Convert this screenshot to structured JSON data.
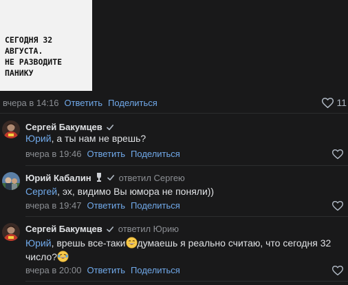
{
  "post": {
    "image_text_line1": "СЕГОДНЯ 32 АВГУСТА.",
    "image_text_line2": "НЕ РАЗВОДИТЕ ПАНИКУ",
    "time": "вчера в 14:16",
    "reply_label": "Ответить",
    "share_label": "Поделиться",
    "likes": "11"
  },
  "comments": [
    {
      "author": "Сергей Бакумцев",
      "reply_to": "",
      "mention": "Юрий",
      "text": ", а ты нам не врешь?",
      "time": "вчера в 19:46",
      "reply_label": "Ответить",
      "share_label": "Поделиться"
    },
    {
      "author": "Юрий Кабалин",
      "reply_to": "ответил Сергею",
      "mention": "Сергей",
      "text": ", эх, видимо Вы юмора не поняли))",
      "time": "вчера в 19:47",
      "reply_label": "Ответить",
      "share_label": "Поделиться"
    },
    {
      "author": "Сергей Бакумцев",
      "reply_to": "ответил Юрию",
      "mention": "Юрий",
      "text_part1": ", врешь все-таки",
      "text_part2": "думаешь я реально считаю, что сегодня 32 число?",
      "time": "вчера в 20:00",
      "reply_label": "Ответить",
      "share_label": "Поделиться"
    }
  ],
  "icons": {
    "like": "heart-icon",
    "verified": "check-icon",
    "badge": "trophy-icon",
    "emoji_1": "grinning-face-icon",
    "emoji_2": "laughing-tears-icon"
  },
  "colors": {
    "background": "#19191a",
    "link": "#71aaeb",
    "muted": "#8c8f94",
    "text": "#e1e3e6"
  }
}
